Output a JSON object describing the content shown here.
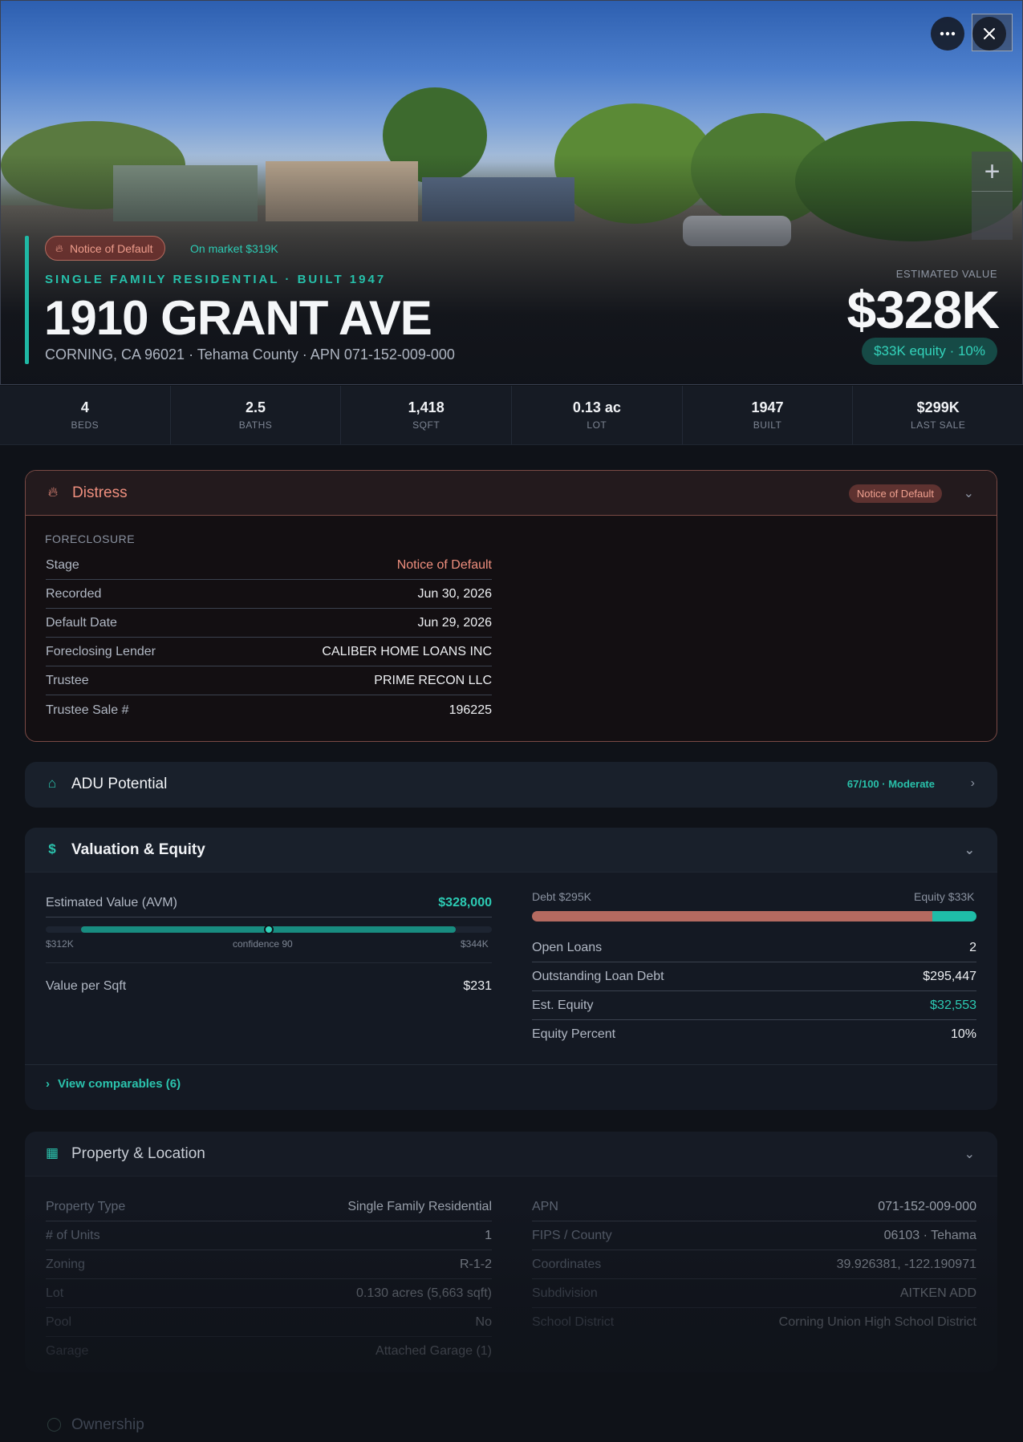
{
  "hero": {
    "badge_distress": "Notice of Default",
    "badge_market": "On market $319K",
    "kicker": "SINGLE FAMILY RESIDENTIAL · BUILT 1947",
    "title": "1910 GRANT AVE",
    "subtitle": "CORNING, CA 96021 · Tehama County · APN 071-152-009-000",
    "estimated_label": "ESTIMATED VALUE",
    "estimated_value": "$328K",
    "equity_pill": "$33K equity · 10%",
    "more_icon": "more-horizontal-icon",
    "close_icon": "close-icon",
    "zoom_icon": "plus-icon"
  },
  "stats": [
    {
      "value": "4",
      "label": "BEDS"
    },
    {
      "value": "2.5",
      "label": "BATHS"
    },
    {
      "value": "1,418",
      "label": "SQFT"
    },
    {
      "value": "0.13 ac",
      "label": "LOT"
    },
    {
      "value": "1947",
      "label": "BUILT"
    },
    {
      "value": "$299K",
      "label": "LAST SALE"
    }
  ],
  "distress": {
    "title": "Distress",
    "pill": "Notice of Default",
    "section": "FORECLOSURE",
    "rows": [
      {
        "k": "Stage",
        "v": "Notice of Default"
      },
      {
        "k": "Recorded",
        "v": "Jun 30, 2026"
      },
      {
        "k": "Default Date",
        "v": "Jun 29, 2026"
      },
      {
        "k": "Foreclosing Lender",
        "v": "CALIBER HOME LOANS INC"
      },
      {
        "k": "Trustee",
        "v": "PRIME RECON LLC"
      },
      {
        "k": "Trustee Sale #",
        "v": "196225"
      }
    ]
  },
  "adu": {
    "title": "ADU Potential",
    "score": "67/100 · Moderate"
  },
  "valuation": {
    "title": "Valuation & Equity",
    "avm_label": "Estimated Value (AVM)",
    "avm_value": "$328,000",
    "avm_low": "$312K",
    "avm_conf": "confidence 90",
    "avm_high": "$344K",
    "avm_position": 0.5,
    "vps_label": "Value per Sqft",
    "vps_value": "$231",
    "debt_label": "Debt $295K",
    "equity_label": "Equity $33K",
    "debt_fraction": 0.9,
    "rows": [
      {
        "k": "Open Loans",
        "v": "2"
      },
      {
        "k": "Outstanding Loan Debt",
        "v": "$295,447"
      },
      {
        "k": "Est. Equity",
        "v": "$32,553"
      },
      {
        "k": "Equity Percent",
        "v": "10%"
      }
    ],
    "comparables": "View comparables (6)"
  },
  "property": {
    "title": "Property & Location",
    "left": [
      {
        "k": "Property Type",
        "v": "Single Family Residential"
      },
      {
        "k": "# of Units",
        "v": "1"
      },
      {
        "k": "Zoning",
        "v": "R-1-2"
      },
      {
        "k": "Lot",
        "v": "0.130 acres (5,663 sqft)"
      },
      {
        "k": "Pool",
        "v": "No"
      },
      {
        "k": "Garage",
        "v": "Attached Garage (1)"
      }
    ],
    "right": [
      {
        "k": "APN",
        "v": "071-152-009-000"
      },
      {
        "k": "FIPS / County",
        "v": "06103 · Tehama"
      },
      {
        "k": "Coordinates",
        "v": "39.926381, -122.190971"
      },
      {
        "k": "Subdivision",
        "v": "AITKEN ADD"
      },
      {
        "k": "School District",
        "v": "Corning Union High School District"
      }
    ]
  },
  "ownership": {
    "title": "Ownership"
  },
  "colors": {
    "accent": "#1fb8a4",
    "distress": "#ef8f7e",
    "debt": "#b56a60",
    "equity": "#1fbda8"
  }
}
